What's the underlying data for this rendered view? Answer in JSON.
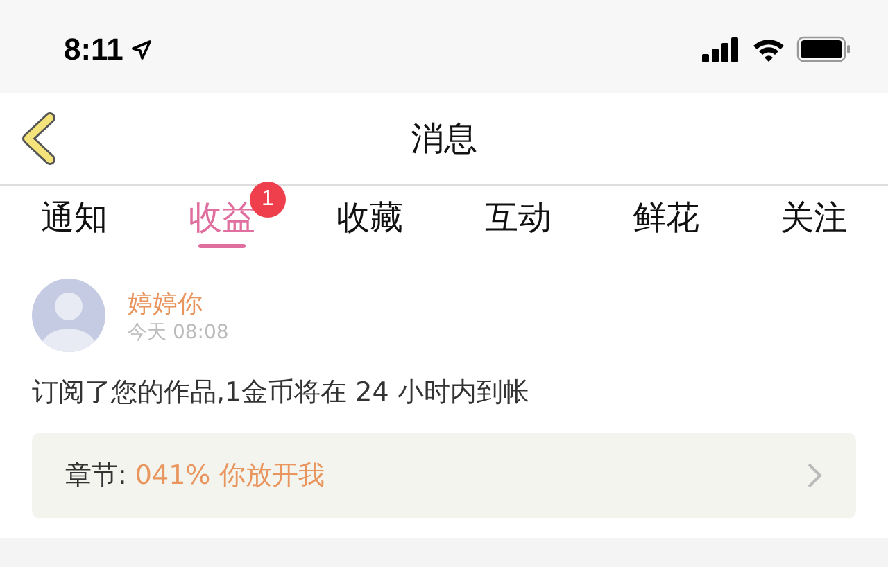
{
  "status_bar": {
    "time": "8:11"
  },
  "header": {
    "title": "消息"
  },
  "tabs": [
    {
      "label": "通知",
      "selected": false
    },
    {
      "label": "收益",
      "selected": true,
      "badge": "1"
    },
    {
      "label": "收藏",
      "selected": false
    },
    {
      "label": "互动",
      "selected": false
    },
    {
      "label": "鲜花",
      "selected": false
    },
    {
      "label": "关注",
      "selected": false
    }
  ],
  "messages": [
    {
      "user": "婷婷你",
      "time": "今天 08:08",
      "text": "订阅了您的作品,1金币将在 24 小时内到帐",
      "chapter_label": "章节:",
      "chapter_title": "041% 你放开我"
    }
  ]
}
